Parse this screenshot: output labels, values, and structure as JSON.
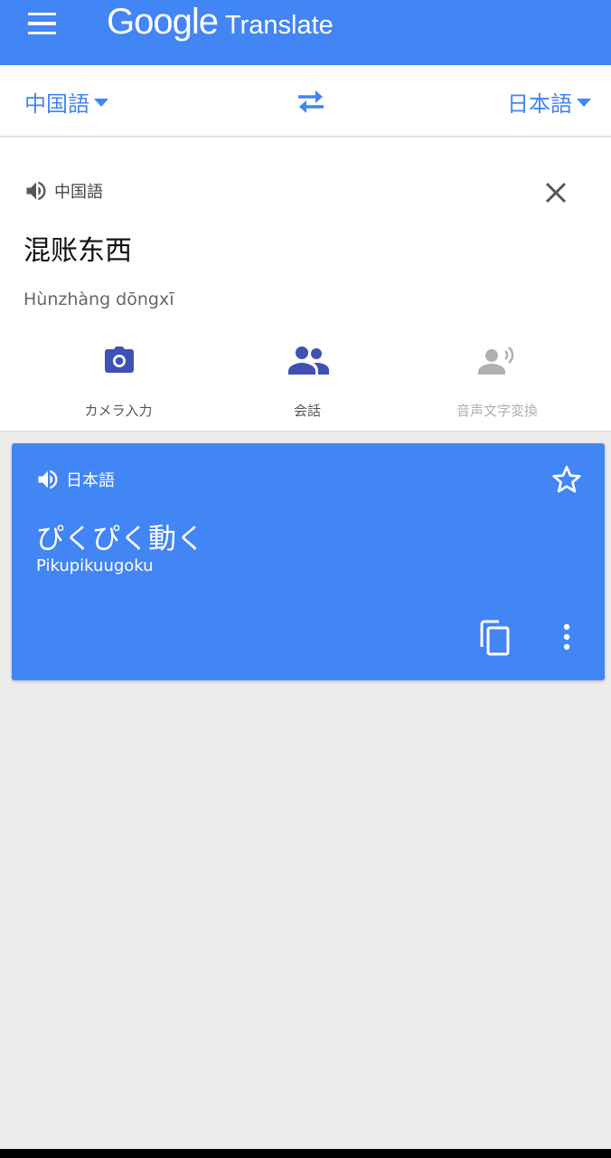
{
  "app": {
    "brand": "Google",
    "product": "Translate"
  },
  "language_bar": {
    "source_language": "中国語",
    "target_language": "日本語"
  },
  "input": {
    "language_label": "中国語",
    "text": "混账东西",
    "romanization": "Hùnzhàng dōngxī"
  },
  "tools": [
    {
      "label": "カメラ入力",
      "icon": "camera-icon",
      "enabled": true
    },
    {
      "label": "会話",
      "icon": "conversation-icon",
      "enabled": true
    },
    {
      "label": "音声文字変換",
      "icon": "transcribe-icon",
      "enabled": false
    }
  ],
  "result": {
    "language_label": "日本語",
    "translation": "ぴくぴく動く",
    "transliteration": "Pikupikuugoku"
  },
  "colors": {
    "primary": "#4285f4",
    "tool_icon": "#3f51b5",
    "disabled": "#b0b0b0",
    "background": "#ececec"
  }
}
